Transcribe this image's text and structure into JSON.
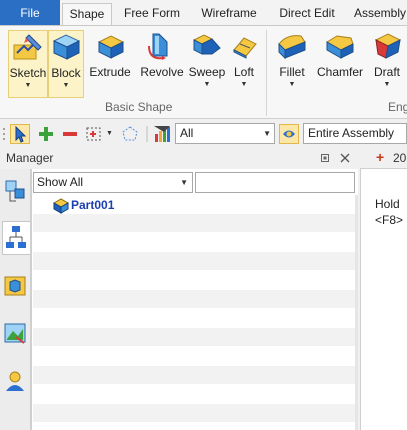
{
  "ribbon_tabs": [
    "File",
    "Shape",
    "Free Form",
    "Wireframe",
    "Direct Edit",
    "Assembly"
  ],
  "ribbon_buttons": {
    "sketch": "Sketch",
    "block": "Block",
    "extrude": "Extrude",
    "revolve": "Revolve",
    "sweep": "Sweep",
    "loft": "Loft",
    "fillet": "Fillet",
    "chamfer": "Chamfer",
    "draft": "Draft"
  },
  "ribbon_groups": {
    "basic_shape": "Basic Shape",
    "engineering_partial": "Eng"
  },
  "toolbar": {
    "filter_value": "All",
    "scope_value": "Entire Assembly"
  },
  "manager": {
    "title": "Manager",
    "filter_value": "Show All",
    "tree_items": [
      "Part001"
    ]
  },
  "right_panel": {
    "tab_label": "20",
    "hint_line1": "Hold",
    "hint_line2": "<F8>"
  },
  "colors": {
    "file_tab": "#2b6fc4",
    "part_label": "#1b3fb0",
    "selected_tool": "#fdf3c8"
  }
}
